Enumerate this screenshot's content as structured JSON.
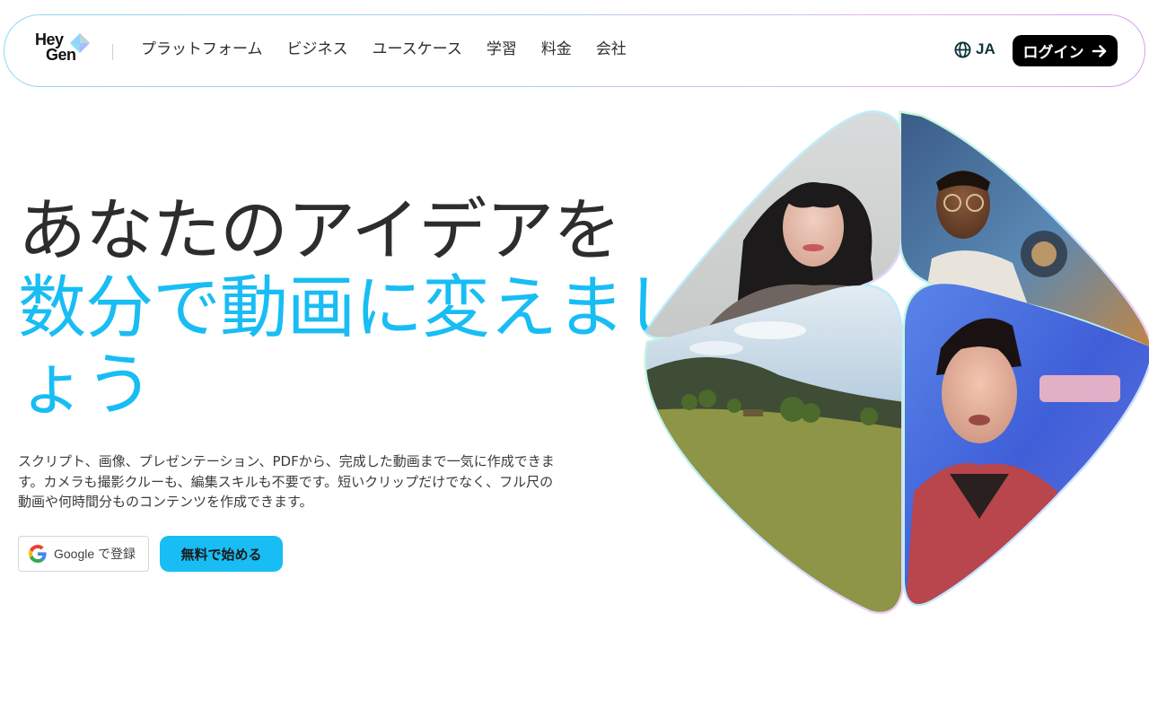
{
  "brand": {
    "logo_line1": "Hey",
    "logo_line2": "Gen"
  },
  "nav": {
    "links": [
      "プラットフォーム",
      "ビジネス",
      "ユースケース",
      "学習",
      "料金",
      "会社"
    ],
    "language": "JA",
    "login_label": "ログイン"
  },
  "hero": {
    "title_line1": "あなたのアイデアを",
    "title_line2": "数分で動画に変えましょう",
    "description": "スクリプト、画像、プレゼンテーション、PDFから、完成した動画まで一気に作成できます。カメラも撮影クルーも、編集スキルも不要です。短いクリップだけでなく、フル尺の動画や何時間分ものコンテンツを作成できます。",
    "google_button": "Google で登録",
    "start_button": "無料で始める"
  },
  "colors": {
    "accent": "#18bdf4",
    "text": "#2d2d2d",
    "login_bg": "#000000"
  },
  "icons": [
    "heygen-logo-icon",
    "globe-icon",
    "arrow-right-icon",
    "google-icon"
  ]
}
